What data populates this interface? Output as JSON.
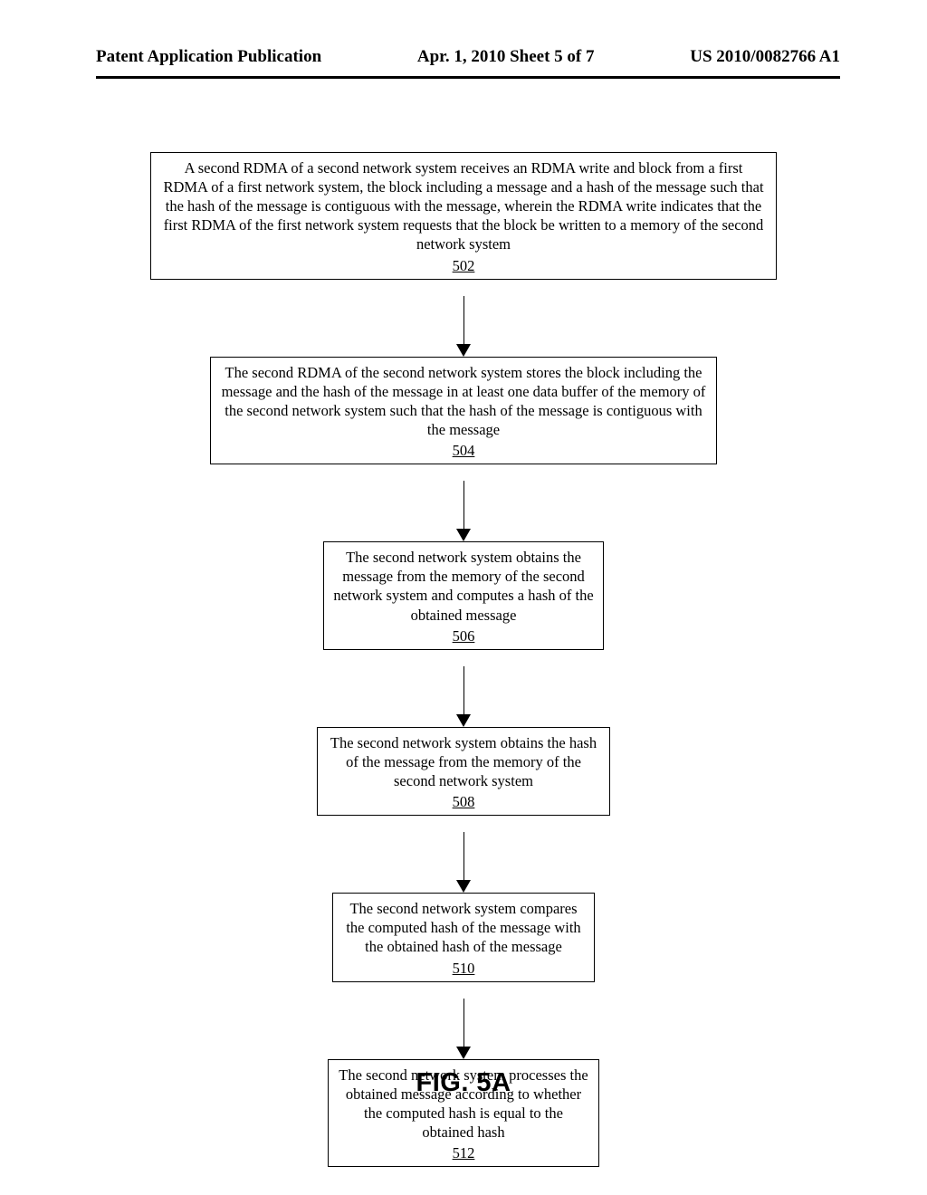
{
  "header": {
    "left": "Patent Application Publication",
    "center": "Apr. 1, 2010 Sheet 5 of 7",
    "right": "US 2010/0082766 A1"
  },
  "figure_label": "FIG. 5A",
  "steps": [
    {
      "num": "502",
      "text": "A second RDMA of a second network system receives an RDMA write and block from a first RDMA of a first network system, the block including a message and a hash of the message such that the hash of the message is contiguous with the message, wherein the RDMA write indicates that the first RDMA of the first network system requests that the block be written to a memory of the second network system"
    },
    {
      "num": "504",
      "text": "The second RDMA of the second network system stores the block including the message and the hash of the message in at least one data buffer of the memory of the second network system such that the hash of the message is contiguous with the message"
    },
    {
      "num": "506",
      "text": "The second network system obtains the message from the memory of the second network system and computes a hash of the obtained message"
    },
    {
      "num": "508",
      "text": "The second network system obtains the hash of the message from the memory of the second network system"
    },
    {
      "num": "510",
      "text": "The second network system compares the computed hash of the message with the obtained hash of the message"
    },
    {
      "num": "512",
      "text": "The second network system processes the obtained message according to whether the computed hash is equal to the obtained hash"
    }
  ]
}
